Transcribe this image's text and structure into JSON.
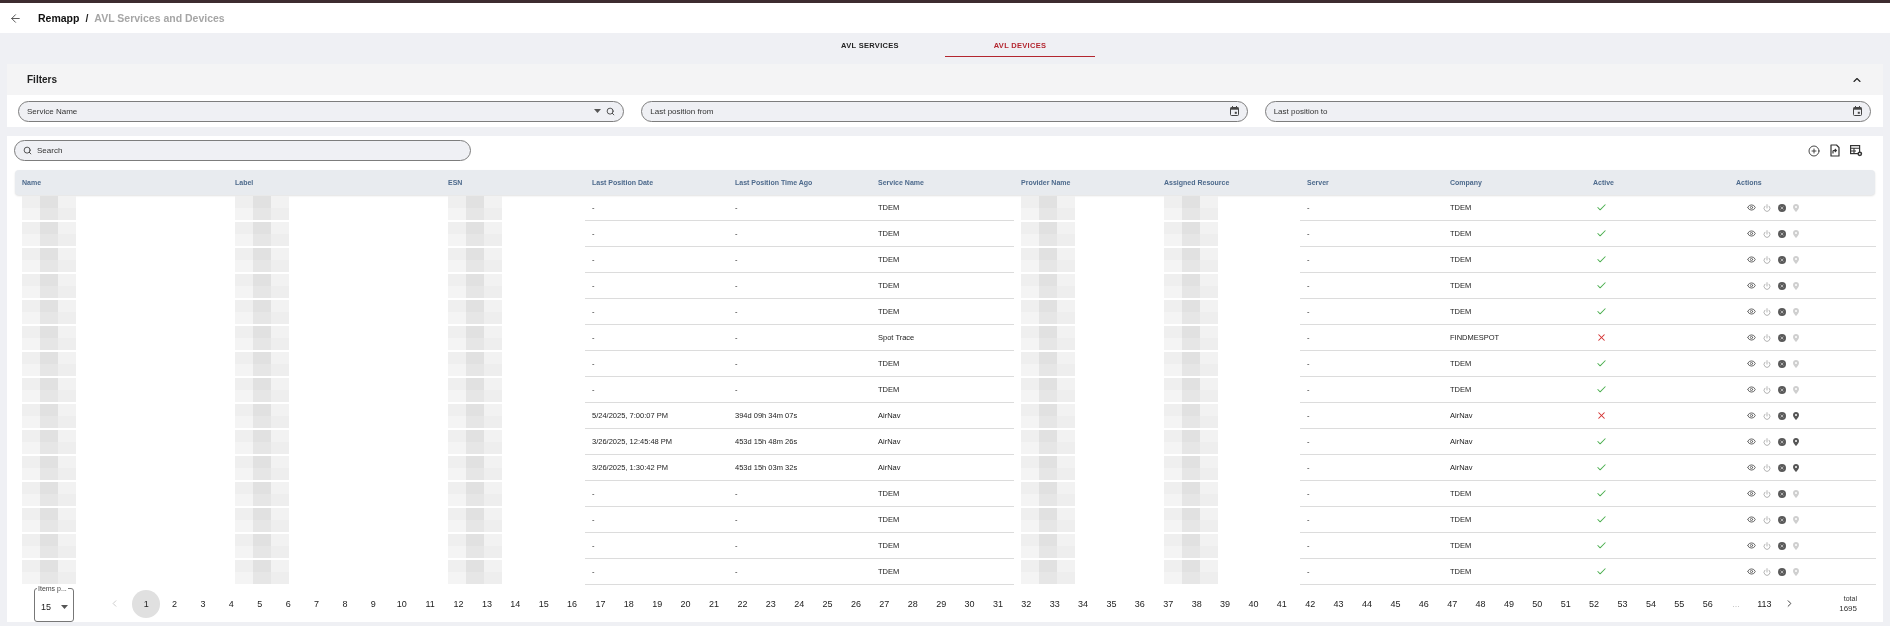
{
  "header": {
    "breadcrumb": [
      {
        "label": "Remapp",
        "current": false
      },
      {
        "label": "AVL Services and Devices",
        "current": true
      }
    ],
    "separator": "/"
  },
  "tabs": [
    {
      "label": "AVL SERVICES",
      "selected": false
    },
    {
      "label": "AVL DEVICES",
      "selected": true
    }
  ],
  "filters": {
    "title": "Filters",
    "expanded": true,
    "fields": [
      {
        "kind": "select",
        "placeholder": "Service Name"
      },
      {
        "kind": "date",
        "placeholder": "Last position from"
      },
      {
        "kind": "date",
        "placeholder": "Last position to"
      }
    ]
  },
  "search": {
    "placeholder": "Search"
  },
  "table": {
    "columns": [
      {
        "label": "Name",
        "kind": "redacted"
      },
      {
        "label": "Label",
        "kind": "redacted"
      },
      {
        "label": "ESN",
        "kind": "redacted"
      },
      {
        "label": "Last Position Date",
        "kind": "text"
      },
      {
        "label": "Last Position Time Ago",
        "kind": "text"
      },
      {
        "label": "Service Name",
        "kind": "text"
      },
      {
        "label": "Provider Name",
        "kind": "redacted"
      },
      {
        "label": "Assigned Resource",
        "kind": "redacted"
      },
      {
        "label": "Server",
        "kind": "text"
      },
      {
        "label": "Company",
        "kind": "text"
      },
      {
        "label": "Active",
        "kind": "status"
      },
      {
        "label": "Actions",
        "kind": "actions"
      }
    ],
    "rows": [
      {
        "texts": [
          "-",
          "-",
          "TDEM",
          "-",
          "TDEM"
        ],
        "active": true,
        "location": false
      },
      {
        "texts": [
          "-",
          "-",
          "TDEM",
          "-",
          "TDEM"
        ],
        "active": true,
        "location": false
      },
      {
        "texts": [
          "-",
          "-",
          "TDEM",
          "-",
          "TDEM"
        ],
        "active": true,
        "location": false
      },
      {
        "texts": [
          "-",
          "-",
          "TDEM",
          "-",
          "TDEM"
        ],
        "active": true,
        "location": false
      },
      {
        "texts": [
          "-",
          "-",
          "TDEM",
          "-",
          "TDEM"
        ],
        "active": true,
        "location": false
      },
      {
        "texts": [
          "-",
          "-",
          "Spot Trace",
          "-",
          "FINDMESPOT"
        ],
        "active": false,
        "location": false
      },
      {
        "texts": [
          "-",
          "-",
          "TDEM",
          "-",
          "TDEM"
        ],
        "active": true,
        "location": false
      },
      {
        "texts": [
          "-",
          "-",
          "TDEM",
          "-",
          "TDEM"
        ],
        "active": true,
        "location": false
      },
      {
        "texts": [
          "5/24/2025, 7:00:07 PM",
          "394d 09h 34m 07s",
          "AirNav",
          "-",
          "AirNav"
        ],
        "active": false,
        "location": true
      },
      {
        "texts": [
          "3/26/2025, 12:45:48 PM",
          "453d 15h 48m 26s",
          "AirNav",
          "-",
          "AirNav"
        ],
        "active": true,
        "location": true
      },
      {
        "texts": [
          "3/26/2025, 1:30:42 PM",
          "453d 15h 03m 32s",
          "AirNav",
          "-",
          "AirNav"
        ],
        "active": true,
        "location": true
      },
      {
        "texts": [
          "-",
          "-",
          "TDEM",
          "-",
          "TDEM"
        ],
        "active": true,
        "location": false
      },
      {
        "texts": [
          "-",
          "-",
          "TDEM",
          "-",
          "TDEM"
        ],
        "active": true,
        "location": false
      },
      {
        "texts": [
          "-",
          "-",
          "TDEM",
          "-",
          "TDEM"
        ],
        "active": true,
        "location": false
      },
      {
        "texts": [
          "-",
          "-",
          "TDEM",
          "-",
          "TDEM"
        ],
        "active": true,
        "location": false
      }
    ]
  },
  "pagination": {
    "items_per_page": {
      "label": "Items p...",
      "value": "15"
    },
    "previous": {
      "disabled": true
    },
    "pages": [
      {
        "label": "1",
        "selected": true
      },
      {
        "label": "2",
        "selected": false
      },
      {
        "label": "3",
        "selected": false
      },
      {
        "label": "4",
        "selected": false
      },
      {
        "label": "5",
        "selected": false
      },
      {
        "label": "6",
        "selected": false
      },
      {
        "label": "7",
        "selected": false
      },
      {
        "label": "8",
        "selected": false
      },
      {
        "label": "9",
        "selected": false
      },
      {
        "label": "10",
        "selected": false
      },
      {
        "label": "11",
        "selected": false
      },
      {
        "label": "12",
        "selected": false
      },
      {
        "label": "13",
        "selected": false
      },
      {
        "label": "14",
        "selected": false
      },
      {
        "label": "15",
        "selected": false
      },
      {
        "label": "16",
        "selected": false
      },
      {
        "label": "17",
        "selected": false
      },
      {
        "label": "18",
        "selected": false
      },
      {
        "label": "19",
        "selected": false
      },
      {
        "label": "20",
        "selected": false
      },
      {
        "label": "21",
        "selected": false
      },
      {
        "label": "22",
        "selected": false
      },
      {
        "label": "23",
        "selected": false
      },
      {
        "label": "24",
        "selected": false
      },
      {
        "label": "25",
        "selected": false
      },
      {
        "label": "26",
        "selected": false
      },
      {
        "label": "27",
        "selected": false
      },
      {
        "label": "28",
        "selected": false
      },
      {
        "label": "29",
        "selected": false
      },
      {
        "label": "30",
        "selected": false
      },
      {
        "label": "31",
        "selected": false
      },
      {
        "label": "32",
        "selected": false
      },
      {
        "label": "33",
        "selected": false
      },
      {
        "label": "34",
        "selected": false
      },
      {
        "label": "35",
        "selected": false
      },
      {
        "label": "36",
        "selected": false
      },
      {
        "label": "37",
        "selected": false
      },
      {
        "label": "38",
        "selected": false
      },
      {
        "label": "39",
        "selected": false
      },
      {
        "label": "40",
        "selected": false
      },
      {
        "label": "41",
        "selected": false
      },
      {
        "label": "42",
        "selected": false
      },
      {
        "label": "43",
        "selected": false
      },
      {
        "label": "44",
        "selected": false
      },
      {
        "label": "45",
        "selected": false
      },
      {
        "label": "46",
        "selected": false
      },
      {
        "label": "47",
        "selected": false
      },
      {
        "label": "48",
        "selected": false
      },
      {
        "label": "49",
        "selected": false
      },
      {
        "label": "50",
        "selected": false
      },
      {
        "label": "51",
        "selected": false
      },
      {
        "label": "52",
        "selected": false
      },
      {
        "label": "53",
        "selected": false
      },
      {
        "label": "54",
        "selected": false
      },
      {
        "label": "55",
        "selected": false
      },
      {
        "label": "56",
        "selected": false
      }
    ],
    "ellipsis": "...",
    "last_page": {
      "label": "113",
      "selected": false
    },
    "next": {
      "disabled": false
    },
    "total_label": "total",
    "total": "1695"
  }
}
